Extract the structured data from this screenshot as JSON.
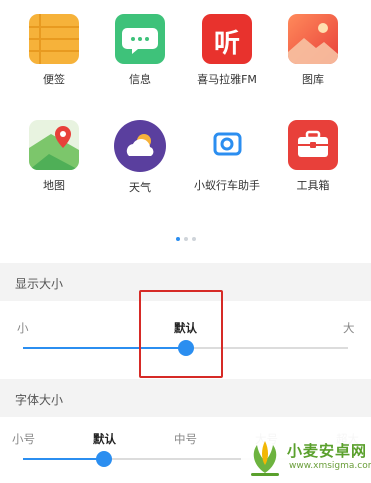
{
  "apps": [
    {
      "label": "便签",
      "icon": "notes-icon"
    },
    {
      "label": "信息",
      "icon": "messages-icon"
    },
    {
      "label": "喜马拉雅FM",
      "icon": "ximalaya-icon",
      "glyph": "听"
    },
    {
      "label": "图库",
      "icon": "gallery-icon"
    },
    {
      "label": "地图",
      "icon": "map-icon"
    },
    {
      "label": "天气",
      "icon": "weather-icon"
    },
    {
      "label": "小蚁行车助手",
      "icon": "camera-icon"
    },
    {
      "label": "工具箱",
      "icon": "toolbox-icon"
    }
  ],
  "pager": {
    "count": 3,
    "active": 0
  },
  "display_size": {
    "title": "显示大小",
    "labels": {
      "small": "小",
      "default": "默认",
      "large": "大"
    },
    "value_fraction": 0.5
  },
  "font_size": {
    "title": "字体大小",
    "labels": [
      "小号",
      "默认",
      "中号",
      "大号",
      "超大"
    ],
    "value_fraction": 0.25
  },
  "watermark": {
    "name": "小麦安卓网",
    "url": "www.xmsigma.com"
  },
  "colors": {
    "accent": "#2b8ef0",
    "annotation": "#d62a26"
  }
}
